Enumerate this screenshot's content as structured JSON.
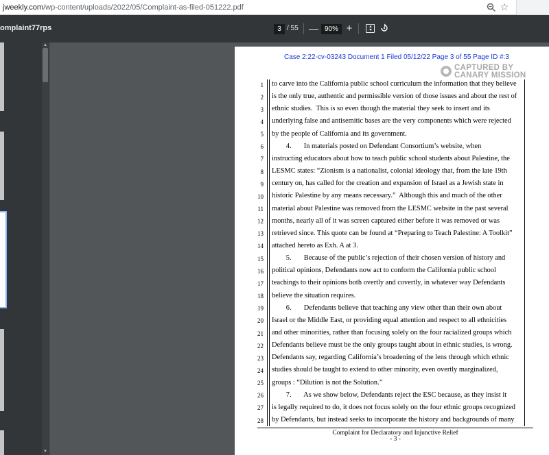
{
  "browser": {
    "url_host": "jweekly.com",
    "url_path": "/wp-content/uploads/2022/05/Complaint-as-filed-051222.pdf",
    "icons": [
      "zoom-icon",
      "star-icon"
    ]
  },
  "toolbar": {
    "doc_title": "omplaint77rps",
    "page_current": "3",
    "page_total": "/ 55",
    "zoom_out_label": "—",
    "zoom_value": "90%",
    "zoom_in_label": "+",
    "icons": [
      "fit-page-icon",
      "rotate-icon"
    ]
  },
  "document": {
    "case_header": "Case 2:22-cv-03243   Document 1   Filed 05/12/22   Page 3 of 55   Page ID #:3",
    "watermark_line1": "CAPTURED BY",
    "watermark_line2": "CANARY MISSION",
    "lines": [
      {
        "n": "1",
        "text": "to carve into the California public school curriculum the information that they believe"
      },
      {
        "n": "2",
        "text": "is the only true, authentic and permissible version of those issues and about the rest of"
      },
      {
        "n": "3",
        "text": "ethnic studies.  This is so even though the material they seek to insert and its"
      },
      {
        "n": "4",
        "text": "underlying false and antisemitic bases are the very components which were rejected"
      },
      {
        "n": "5",
        "text": "by the people of California and its government."
      },
      {
        "n": "6",
        "text": "        4.       In materials posted on Defendant Consortium’s website, when"
      },
      {
        "n": "7",
        "text": "instructing educators about how to teach public school students about Palestine, the"
      },
      {
        "n": "8",
        "text": "LESMC states: “Zionism is a nationalist, colonial ideology that, from the late 19th"
      },
      {
        "n": "9",
        "text": "century on, has called for the creation and expansion of Israel as a Jewish state in"
      },
      {
        "n": "10",
        "text": "historic Palestine by any means necessary.”  Although this and much of the other"
      },
      {
        "n": "11",
        "text": "material about Palestine was removed from the LESMC website in the past several"
      },
      {
        "n": "12",
        "text": "months, nearly all of it was screen captured either before it was removed or was"
      },
      {
        "n": "13",
        "text": "retrieved since. This quote can be found at “Preparing to Teach Palestine: A Toolkit”"
      },
      {
        "n": "14",
        "text": "attached hereto as Exh. A at 3."
      },
      {
        "n": "15",
        "text": "        5.       Because of the public’s rejection of their chosen version of history and"
      },
      {
        "n": "16",
        "text": "political opinions, Defendants now act to conform the California public school"
      },
      {
        "n": "17",
        "text": "teachings to their opinions both overtly and covertly, in whatever way Defendants"
      },
      {
        "n": "18",
        "text": "believe the situation requires."
      },
      {
        "n": "19",
        "text": "        6.       Defendants believe that teaching any view other than their own about"
      },
      {
        "n": "20",
        "text": "Israel or the Middle East, or providing equal attention and respect to all ethnicities"
      },
      {
        "n": "21",
        "text": "and other minorities, rather than focusing solely on the four racialized groups which"
      },
      {
        "n": "22",
        "text": "Defendants believe must be the only groups taught about in ethnic studies, is wrong."
      },
      {
        "n": "23",
        "text": "Defendants say, regarding California’s broadening of the lens through which ethnic"
      },
      {
        "n": "24",
        "text": "studies should be taught to extend to other minority, even overtly marginalized,"
      },
      {
        "n": "25",
        "text": "groups : “Dilution is not the Solution.”"
      },
      {
        "n": "26",
        "text": "        7.       As we show below, Defendants reject the ESC because, as they insist it"
      },
      {
        "n": "27",
        "text": "is legally required to do, it does not focus solely on the four ethnic groups recognized"
      },
      {
        "n": "28",
        "text": "by Defendants, but instead seeks to incorporate the history and backgrounds of many"
      }
    ],
    "footer_title": "Complaint for Declaratory and Injunctive Relief",
    "footer_page": "- 3 -"
  },
  "colors": {
    "toolbar_bg": "#323639",
    "viewer_bg": "#525659",
    "case_header": "#1a3ad6",
    "thumb_active_border": "#8ab4f8"
  }
}
